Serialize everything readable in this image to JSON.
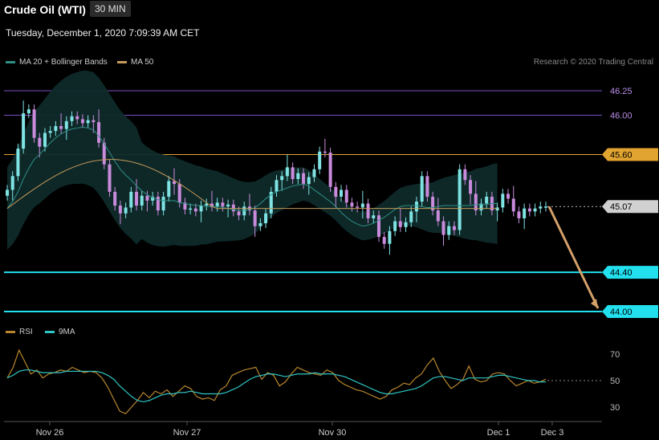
{
  "header": {
    "title": "Crude Oil (WTI)",
    "interval": "30 MIN",
    "datetime": "Tuesday, December 1, 2020 7:09:39 AM CET"
  },
  "legend": {
    "ma20": "MA 20 + Bollinger Bands",
    "ma50": "MA 50",
    "credit": "Research © 2020 Trading Central",
    "rsi": "RSI",
    "ma9": "9MA"
  },
  "colors": {
    "background": "#000000",
    "bull_candle": "#7fe3e3",
    "bear_candle": "#c98bdc",
    "bollinger_fill": "#0f2a2a",
    "ma20": "#2f8f86",
    "ma50": "#c49a5a",
    "resistance_top": "#7a4ec0",
    "resistance_mid": "#e2a430",
    "support": "#22e0ee",
    "arrow": "#d4a06a",
    "rsi": "#b8862e",
    "rsi_ma": "#2fc5c5"
  },
  "chart_data": [
    {
      "type": "candlestick",
      "title": "Crude Oil (WTI)",
      "ylim": [
        43.93,
        46.37
      ],
      "x_ticks": [
        "Nov 26",
        "Nov 27",
        "Nov 30",
        "Dec 1",
        "Dec 3"
      ],
      "levels": [
        {
          "value": 46.25,
          "label": "46.25",
          "style": "resistance"
        },
        {
          "value": 46.0,
          "label": "46.00",
          "style": "resistance"
        },
        {
          "value": 45.6,
          "label": "45.60",
          "style": "pivot"
        },
        {
          "value": 45.07,
          "label": "45.07",
          "style": "last"
        },
        {
          "value": 44.4,
          "label": "44.40",
          "style": "support"
        },
        {
          "value": 44.0,
          "label": "44.00",
          "style": "support"
        }
      ],
      "projection": {
        "from": 45.07,
        "to": 44.0
      },
      "closes": [
        45.24,
        45.38,
        45.66,
        46.02,
        46.06,
        45.77,
        45.68,
        45.82,
        45.84,
        45.89,
        45.86,
        45.94,
        45.99,
        45.96,
        45.92,
        45.95,
        45.93,
        45.72,
        45.5,
        45.22,
        45.08,
        45.0,
        45.06,
        45.22,
        45.08,
        45.18,
        45.13,
        45.17,
        45.03,
        45.17,
        45.33,
        45.3,
        45.11,
        45.04,
        45.05,
        45.02,
        45.08,
        45.1,
        45.07,
        45.11,
        45.07,
        45.09,
        45.02,
        44.98,
        45.07,
        45.03,
        44.87,
        44.9,
        45.0,
        45.22,
        45.34,
        45.38,
        45.47,
        45.35,
        45.41,
        45.3,
        45.37,
        45.45,
        45.63,
        45.62,
        45.27,
        45.17,
        45.24,
        45.11,
        45.07,
        45.06,
        45.1,
        44.95,
        44.98,
        44.76,
        44.69,
        44.82,
        44.92,
        44.86,
        44.91,
        45.02,
        45.12,
        45.38,
        45.17,
        45.03,
        44.92,
        44.78,
        44.87,
        44.83,
        45.45,
        45.34,
        45.2,
        45.03,
        45.1,
        45.17,
        45.03,
        45.06,
        45.2,
        45.15,
        45.02,
        44.95,
        45.05,
        45.02,
        45.05,
        45.07,
        45.07
      ],
      "ma20": [
        45.05,
        45.12,
        45.22,
        45.35,
        45.46,
        45.55,
        45.6,
        45.66,
        45.72,
        45.77,
        45.81,
        45.84,
        45.86,
        45.87,
        45.88,
        45.87,
        45.85,
        45.79,
        45.71,
        45.62,
        45.53,
        45.45,
        45.39,
        45.34,
        45.28,
        45.23,
        45.19,
        45.16,
        45.14,
        45.13,
        45.13,
        45.13,
        45.11,
        45.1,
        45.09,
        45.08,
        45.08,
        45.07,
        45.07,
        45.07,
        45.06,
        45.05,
        45.04,
        45.03,
        45.03,
        45.04,
        45.06,
        45.1,
        45.15,
        45.19,
        45.22,
        45.24,
        45.26,
        45.28,
        45.29,
        45.3,
        45.28,
        45.24,
        45.2,
        45.16,
        45.12,
        45.07,
        45.01,
        44.96,
        44.92,
        44.89,
        44.87,
        44.88,
        44.9,
        44.93,
        44.96,
        45.0,
        45.04,
        45.07,
        45.08,
        45.08,
        45.08,
        45.07,
        45.06,
        45.06,
        45.07,
        45.08,
        45.08,
        45.08,
        45.08,
        45.08,
        45.08,
        45.09,
        45.09,
        45.09,
        45.1,
        45.1
      ]
    },
    {
      "type": "line",
      "title": "RSI",
      "ylim": [
        20,
        80
      ],
      "y_ticks": [
        70,
        50,
        30
      ],
      "series": [
        {
          "name": "RSI",
          "values": [
            52,
            60,
            73,
            64,
            55,
            58,
            52,
            55,
            56,
            58,
            57,
            60,
            58,
            56,
            57,
            56,
            52,
            45,
            36,
            27,
            25,
            30,
            35,
            41,
            37,
            42,
            40,
            43,
            38,
            42,
            46,
            44,
            38,
            36,
            37,
            35,
            43,
            46,
            54,
            56,
            58,
            59,
            60,
            51,
            56,
            54,
            46,
            49,
            55,
            60,
            58,
            56,
            55,
            54,
            58,
            56,
            50,
            47,
            45,
            43,
            42,
            40,
            38,
            36,
            38,
            43,
            45,
            48,
            47,
            52,
            55,
            62,
            67,
            57,
            50,
            44,
            47,
            51,
            61,
            51,
            49,
            50,
            55,
            56,
            55,
            50,
            46,
            48,
            50,
            48,
            49,
            51
          ]
        },
        {
          "name": "9MA",
          "values": [
            52,
            54,
            57,
            58,
            58,
            57,
            56,
            56,
            56,
            56,
            57,
            57,
            57,
            57,
            57,
            57,
            56,
            54,
            51,
            46,
            42,
            38,
            35,
            34,
            35,
            37,
            39,
            40,
            40,
            41,
            41,
            42,
            41,
            40,
            40,
            40,
            40,
            41,
            43,
            45,
            48,
            51,
            53,
            54,
            55,
            55,
            54,
            53,
            54,
            55,
            55,
            55,
            56,
            55,
            55,
            55,
            54,
            53,
            51,
            49,
            47,
            45,
            43,
            41,
            40,
            40,
            41,
            42,
            43,
            44,
            46,
            49,
            52,
            53,
            53,
            52,
            51,
            50,
            52,
            52,
            52,
            52,
            53,
            54,
            54,
            53,
            52,
            51,
            50,
            50,
            49,
            49
          ]
        }
      ]
    }
  ]
}
